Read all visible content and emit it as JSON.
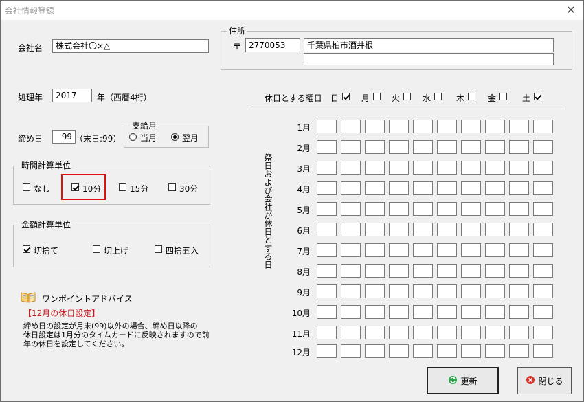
{
  "window": {
    "title": "会社情報登録",
    "close_glyph": "✕"
  },
  "company": {
    "label": "会社名",
    "value": "株式会社〇×△"
  },
  "address": {
    "legend": "住所",
    "postal_mark": "〒",
    "postal_code": "2770053",
    "line1": "千葉県柏市酒井根",
    "line2": ""
  },
  "year": {
    "label": "処理年",
    "value": "2017",
    "suffix": "年（西暦4桁）"
  },
  "closing": {
    "label": "締め日",
    "value": "99",
    "suffix": "（末日:99）"
  },
  "payday": {
    "legend": "支給月",
    "options": [
      {
        "label": "当月",
        "checked": false
      },
      {
        "label": "翌月",
        "checked": true
      }
    ]
  },
  "time_unit": {
    "legend": "時間計算単位",
    "options": [
      {
        "label": "なし",
        "checked": false
      },
      {
        "label": "10分",
        "checked": true
      },
      {
        "label": "15分",
        "checked": false
      },
      {
        "label": "30分",
        "checked": false
      }
    ]
  },
  "money_unit": {
    "legend": "金額計算単位",
    "options": [
      {
        "label": "切捨て",
        "checked": true
      },
      {
        "label": "切上げ",
        "checked": false
      },
      {
        "label": "四捨五入",
        "checked": false
      }
    ]
  },
  "weekly_holiday": {
    "label": "休日とする曜日",
    "days": [
      {
        "label": "日",
        "checked": true
      },
      {
        "label": "月",
        "checked": false
      },
      {
        "label": "火",
        "checked": false
      },
      {
        "label": "水",
        "checked": false
      },
      {
        "label": "木",
        "checked": false
      },
      {
        "label": "金",
        "checked": false
      },
      {
        "label": "土",
        "checked": true
      }
    ]
  },
  "holiday_grid": {
    "side_label": "祭日および会社が休日とする日",
    "months": [
      "1月",
      "2月",
      "3月",
      "4月",
      "5月",
      "6月",
      "7月",
      "8月",
      "9月",
      "10月",
      "11月",
      "12月"
    ]
  },
  "advice": {
    "icon": "book-icon",
    "title": "ワンポイントアドバイス",
    "heading": "【12月の休日設定】",
    "lines": [
      "締め日の設定が月末(99)以外の場合、締め日以降の",
      "休日設定は1月分のタイムカードに反映されますので前",
      "年の休日を設定してください。"
    ]
  },
  "buttons": {
    "update": {
      "label": "更新",
      "icon": "refresh-icon",
      "icon_color": "#2aa34a"
    },
    "close": {
      "label": "閉じる",
      "icon": "close-circle-icon",
      "icon_color": "#d9342b"
    }
  }
}
